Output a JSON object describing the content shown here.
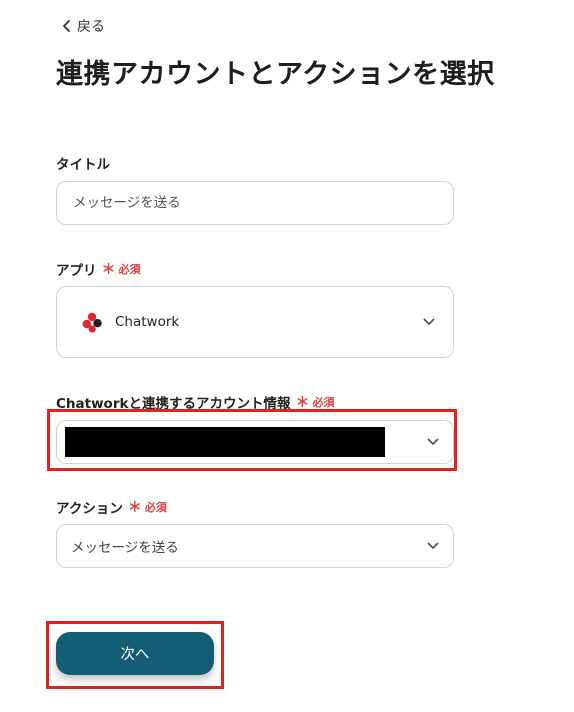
{
  "nav": {
    "back_label": "戻る"
  },
  "page": {
    "title": "連携アカウントとアクションを選択"
  },
  "form": {
    "title_field": {
      "label": "タイトル",
      "value": "",
      "placeholder": "メッセージを送る"
    },
    "app_field": {
      "label": "アプリ",
      "required_mark": "＊",
      "required_label": "必須",
      "selected_app": "Chatwork",
      "app_icon": "chatwork-logo"
    },
    "account_field": {
      "label": "Chatworkと連携するアカウント情報",
      "required_mark": "＊",
      "required_label": "必須",
      "value_redacted": true
    },
    "action_field": {
      "label": "アクション",
      "required_mark": "＊",
      "required_label": "必須",
      "selected_value": "メッセージを送る"
    }
  },
  "footer": {
    "next_label": "次へ"
  },
  "colors": {
    "primary_button": "#135e76",
    "required": "#e0403c",
    "highlight": "#e3201b",
    "border": "#d0d3d8"
  }
}
